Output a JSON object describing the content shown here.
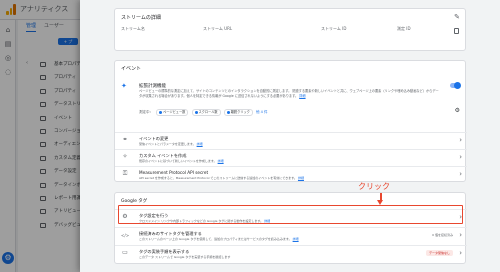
{
  "app": {
    "title": "アナリティクス"
  },
  "bg_tabs": [
    "管理",
    "ユーザー"
  ],
  "bg_button": "+ プ",
  "bg_items": [
    "基本プロパティ",
    "プロパティ",
    "プロパティ",
    "データストリーム",
    "イベント",
    "コンバージョン",
    "オーディエンス",
    "カスタム定義",
    "データ設定",
    "データインポート",
    "レポート用識別",
    "アトリビューション",
    "デバッグビュー"
  ],
  "stream_details": {
    "header": "ストリームの詳細",
    "labels": [
      "ストリーム名",
      "ストリーム URL",
      "ストリーム ID",
      "測定 ID"
    ]
  },
  "events": {
    "header": "イベント",
    "enhanced": {
      "title": "拡張計測機能",
      "desc": "ページビューの標準的な測定に加えて、サイトのコンテンツとのインタラクションを自動的に測定します。",
      "desc2": "関連する要素や新しいイベントと共に、ウェブページ上の要素（リンクや埋め込み動画など）からデータが収集される場合があります。個人を特定できる情報が Google に送信されないようにする必要があります。",
      "link": "詳細",
      "measuring": "測定中：",
      "chips": [
        "ページビュー数",
        "スクロール数",
        "離脱クリック"
      ],
      "more": "他 4 件"
    },
    "rows": [
      {
        "icon": "⚭",
        "title": "イベントの変更",
        "desc": "受信イベントとパラメータを変更します。",
        "link": "詳細"
      },
      {
        "icon": "✧",
        "title": "カスタム イベントを作成",
        "desc": "既存のイベントに基づいて新しいイベントを作成します。",
        "link": "詳細"
      },
      {
        "icon": "⚿",
        "title": "Measurement Protocol API secret",
        "desc": "API secret を作成すると、Measurement Protocol でこのストリームに送信する追加のイベントを有効にできます。",
        "link": "詳細"
      }
    ]
  },
  "google_tag": {
    "header": "Google タグ",
    "rows": [
      {
        "icon": "⚙",
        "title": "タグ設定を行う",
        "desc": "クロスドメイン リンクや内部トラフィックなどの Google タグに関する動作を設定します。",
        "link": "詳細",
        "badge": ""
      },
      {
        "icon": "</>",
        "title": "接続済みのサイトタグを管理する",
        "desc": "このストリームのページ上の Google タグを使用して、追加のプロパティまたはサービスのタグを読み込みます。",
        "link": "詳細",
        "badge": "0 個を接続済み"
      },
      {
        "icon": "▭",
        "title": "タグの実装手順を表示する",
        "desc": "このデータ ストリームで Google タグを実装する手順を確認します",
        "link": "",
        "badge": "データ受信なし"
      }
    ]
  },
  "annotation": {
    "label": "クリック"
  }
}
